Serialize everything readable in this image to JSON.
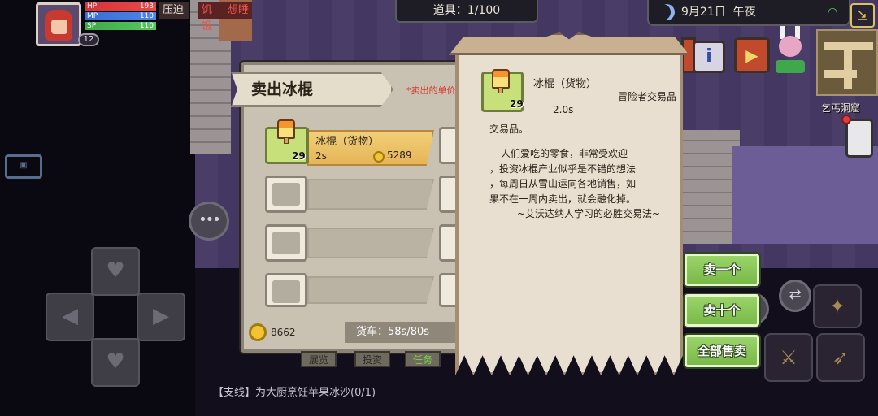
{
  "hud": {
    "hp_label": "HP",
    "hp_value": "193",
    "mp_label": "MP",
    "mp_value": "110",
    "sp_label": "SP",
    "sp_value": "110",
    "level": "12",
    "status_1": "压迫",
    "status_2": "饥饿",
    "status_3": "想睡"
  },
  "top_bar": {
    "items_count": "道具：1/100",
    "date": "9月21日",
    "time_of_day": "午夜"
  },
  "location": {
    "name": "乞丐洞窟"
  },
  "sell_panel": {
    "title": "卖出冰棍",
    "note": "*卖出的单价",
    "item": {
      "name": "冰棍（货物）",
      "time": "2s",
      "price": "5289",
      "quantity": "29"
    },
    "gold": "8662",
    "cart": "货车：58s/80s",
    "tabs_behind": [
      "展览",
      "投资",
      "任务"
    ]
  },
  "tooltip": {
    "item_name": "冰棍（货物）",
    "quantity": "29",
    "source": "冒险者交易品",
    "duration": "2.0s",
    "type": "交易品。",
    "description_lines": [
      "人们爱吃的零食，非常受欢迎",
      "，投资冰棍产业似乎是不错的想法",
      "，每周日从雪山运向各地销售，如",
      "果不在一周内卖出，就会融化掉。",
      "~艾沃达纳人学习的必胜交易法~"
    ]
  },
  "actions": {
    "sell_one": "卖一个",
    "sell_ten": "卖十个",
    "sell_all": "全部售卖"
  },
  "quest": {
    "text": "【支线】为大厨烹饪苹果冰沙(0/1)"
  },
  "colors": {
    "accent_green": "#79b948",
    "warning_red": "#d4382c",
    "gold": "#f0c531"
  }
}
